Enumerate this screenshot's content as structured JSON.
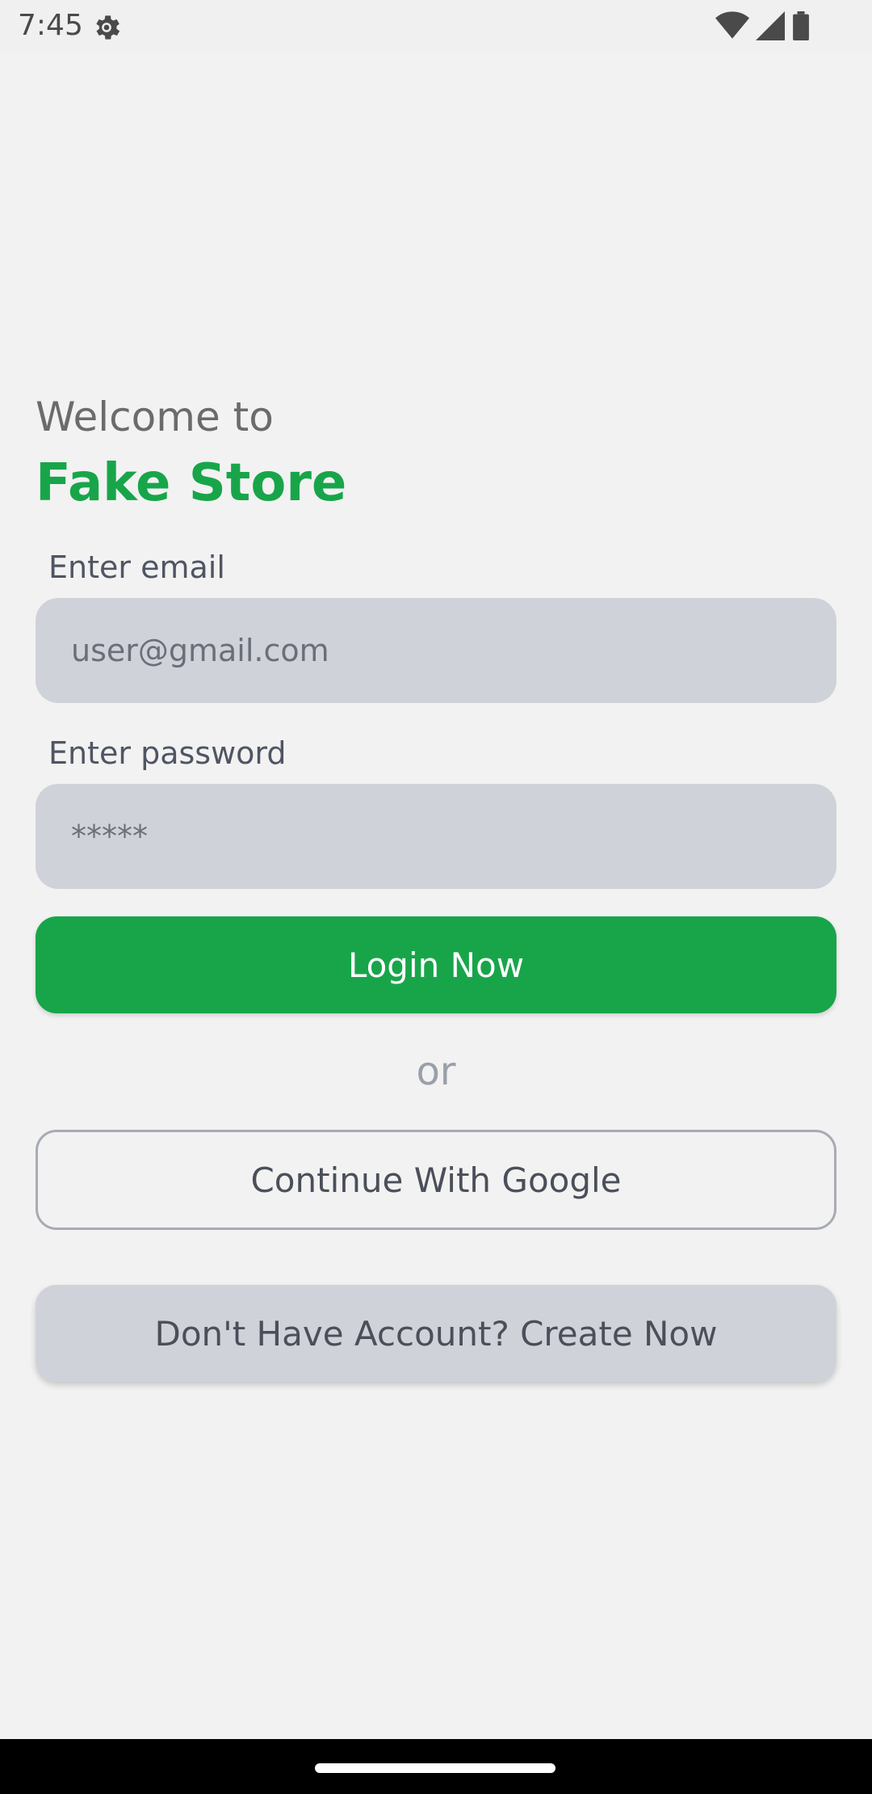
{
  "status_bar": {
    "time": "7:45",
    "icons": [
      "settings-gear-icon",
      "wifi-icon",
      "signal-icon",
      "battery-icon"
    ]
  },
  "login": {
    "welcome_text": "Welcome to",
    "brand_name": "Fake Store",
    "email_label": "Enter email",
    "email_value": "user@gmail.com",
    "password_label": "Enter password",
    "password_value": "*****",
    "login_button": "Login Now",
    "or_text": "or",
    "google_button": "Continue With Google",
    "create_account_button": "Don't Have Account? Create Now"
  },
  "colors": {
    "brand_green": "#18a54a",
    "field_bg": "#d0d2d9",
    "background": "#f2f2f2"
  }
}
